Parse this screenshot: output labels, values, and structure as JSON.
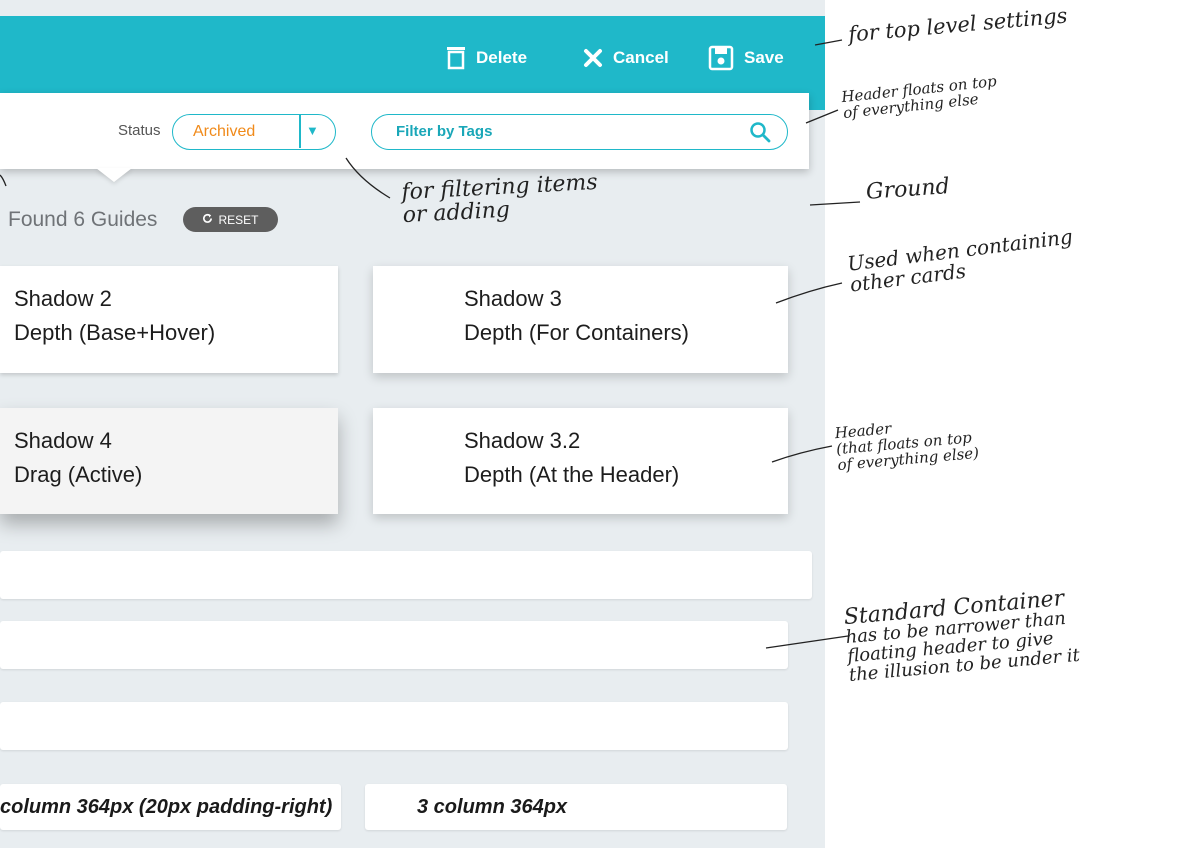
{
  "toolbar": {
    "delete_label": "Delete",
    "cancel_label": "Cancel",
    "save_label": "Save",
    "delete_icon": "trash-icon",
    "cancel_icon": "close-icon",
    "save_icon": "save-icon"
  },
  "header": {
    "status_label": "Status",
    "status_value": "Archived",
    "status_arrow": "▼",
    "filter_placeholder": "Filter by Tags",
    "filter_icon": "search-icon"
  },
  "results": {
    "found_text": "Found 6 Guides",
    "reset_label": "RESET",
    "reset_icon": "refresh-icon"
  },
  "cards": [
    {
      "title": "Shadow 2",
      "subtitle": "Depth (Base+Hover)"
    },
    {
      "title": "Shadow 3",
      "subtitle": "Depth (For Containers)"
    },
    {
      "title": "Shadow 4",
      "subtitle": "Drag (Active)"
    },
    {
      "title": "Shadow 3.2",
      "subtitle": "Depth (At the Header)"
    }
  ],
  "columns": {
    "left_label": "column 364px (20px padding-right)",
    "right_label": "3 column 364px"
  },
  "annotations": {
    "top_level": "for top level settings",
    "header_floats_1": "Header floats on top",
    "header_floats_2": "of everything else",
    "filtering_1": "for filtering items",
    "filtering_2": "or adding",
    "ground": "Ground",
    "containing_1": "Used when containing",
    "containing_2": "other cards",
    "header2_1": "Header",
    "header2_2": "(that floats on top",
    "header2_3": "of everything else)",
    "standard_1": "Standard Container",
    "standard_2": "has to be narrower than",
    "standard_3": "floating header to give",
    "standard_4": "the illusion to be under it"
  },
  "colors": {
    "accent": "#1fb8c9",
    "status_value": "#f08a1a",
    "ground": "#e8edf0"
  }
}
